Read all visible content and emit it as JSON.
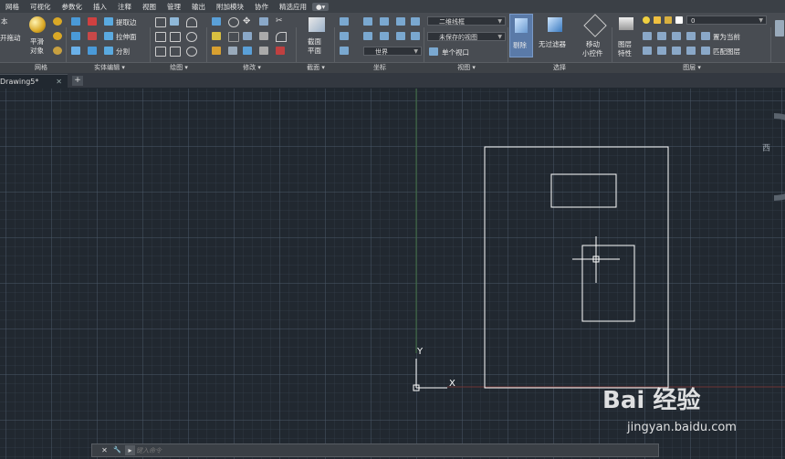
{
  "menubar": {
    "items": [
      "网格",
      "可视化",
      "参数化",
      "插入",
      "注释",
      "视图",
      "管理",
      "输出",
      "附加模块",
      "协作",
      "精选应用"
    ]
  },
  "ribbon": {
    "left_edge": {
      "line1": "本",
      "line2": "开拖动"
    },
    "smooth": {
      "line1": "平滑",
      "line2": "对象"
    },
    "solid_edit": {
      "extract_edge": "提取边",
      "extrude_face": "拉伸面",
      "separate": "分割"
    },
    "section": {
      "line1": "截面",
      "line2": "平面"
    },
    "coords": {
      "ucs_value": "世界"
    },
    "view": {
      "visual_style": "二维线框",
      "saved_view": "未保存的视图",
      "viewport": "单个视口"
    },
    "select": {
      "culling": "剔除",
      "no_filter": "无过滤器",
      "gizmo_line1": "移动",
      "gizmo_line2": "小控件"
    },
    "layers": {
      "properties_line1": "图层",
      "properties_line2": "特性",
      "current_layer": "0",
      "set_current": "置为当前",
      "match_layer": "匹配图层"
    }
  },
  "panel_titles": {
    "mesh": "网格",
    "solid_edit": "实体编辑 ▾",
    "draw": "绘图 ▾",
    "modify": "修改 ▾",
    "section": "截面 ▾",
    "coordinates": "坐标",
    "view": "视图 ▾",
    "selection": "选择",
    "layers": "图层 ▾"
  },
  "tabs": {
    "active": "Drawing5*",
    "close": "✕",
    "add": "+"
  },
  "canvas": {
    "ucs_y": "Y",
    "ucs_x": "X",
    "viewcube_west": "西"
  },
  "command": {
    "placeholder": "键入命令",
    "close": "✕",
    "settings": "🔧"
  },
  "watermark": {
    "logo": "Bai  经验",
    "url": "jingyan.baidu.com"
  },
  "colors": {
    "canvas": "#212830",
    "ribbon": "#484c52",
    "ucs_y_axis": "#4a8a4a",
    "ucs_x_axis": "#8a3a3a",
    "geometry": "#ffffff"
  }
}
